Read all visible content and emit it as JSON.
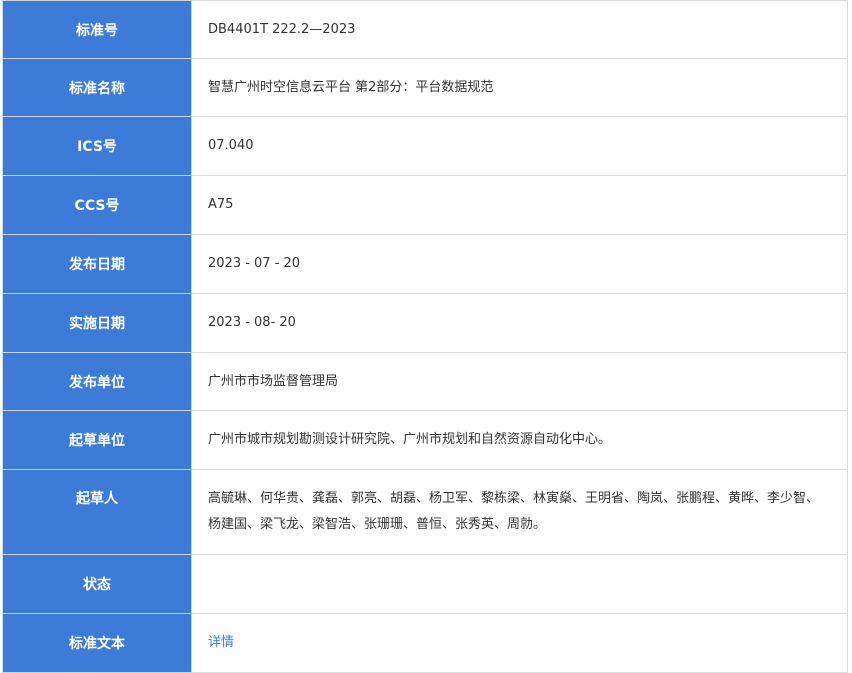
{
  "rows": [
    {
      "label": "标准号",
      "value": "DB4401T 222.2—2023"
    },
    {
      "label": "标准名称",
      "value": "智慧广州时空信息云平台 第2部分：平台数据规范"
    },
    {
      "label": "ICS号",
      "value": "07.040"
    },
    {
      "label": "CCS号",
      "value": "A75"
    },
    {
      "label": "发布日期",
      "value": "2023 - 07 - 20"
    },
    {
      "label": "实施日期",
      "value": "2023 - 08- 20"
    },
    {
      "label": "发布单位",
      "value": "广州市市场监督管理局"
    },
    {
      "label": "起草单位",
      "value": "广州市城市规划勘测设计研究院、广州市规划和自然资源自动化中心。"
    },
    {
      "label": "起草人",
      "value": "高毓琳、何华贵、龚磊、郭亮、胡磊、杨卫军、黎栋梁、林寅燊、王明省、陶岚、张鹏程、黄晔、李少智、杨建国、梁飞龙、梁智浩、张珊珊、普恒、张秀英、周勍。"
    },
    {
      "label": "状态",
      "value": ""
    },
    {
      "label": "标准文本",
      "value": "详情"
    }
  ]
}
